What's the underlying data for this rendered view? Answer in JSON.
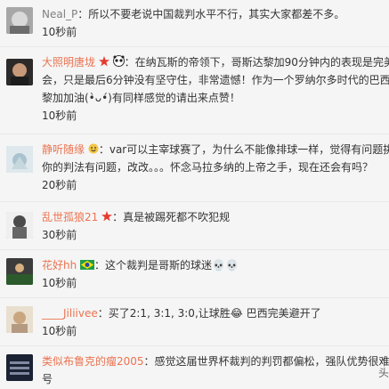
{
  "comments": [
    {
      "name": "Neal_P",
      "name_color": "#808080",
      "text_lines": [
        "：所以不要老说中国裁判水平不行，其实大家都差不多。"
      ],
      "time": "10秒前",
      "icons": []
    },
    {
      "name": "大照明唐垅",
      "name_color": "#eb7350",
      "text_lines": [
        "：在纳瓦斯的帝领下，哥斯达黎加90分钟内的表现是完美",
        "会，只是最后6分钟没有坚守住，非常遗憾！作为一个罗纳尔多时代的巴西",
        "黎加加油(•̀ᴗ•́)有同样感觉的请出来点赞！"
      ],
      "time": "10秒前",
      "icons": [
        "red-star-icon",
        "panda-icon"
      ]
    },
    {
      "name": "静听随缘",
      "name_color": "#eb7350",
      "text_lines": [
        "：var可以主宰球赛了，为什么不能像排球一样，觉得有问题挑战",
        "你的判法有问题，改改。。。怀念马拉多纳的上帝之手，现在还会有吗？"
      ],
      "time": "20秒前",
      "icons": [
        "emoji-icon"
      ]
    },
    {
      "name": "乱世孤狼21",
      "name_color": "#eb7350",
      "text_lines": [
        "：真是被踢死都不吹犯规"
      ],
      "time": "30秒前",
      "icons": [
        "red-star-icon"
      ]
    },
    {
      "name": "花好hh",
      "name_color": "#eb7350",
      "text_lines": [
        "：这个裁判是哥斯的球迷💀💀"
      ],
      "time": "10秒前",
      "icons": [
        "brazil-flag-icon"
      ]
    },
    {
      "name": "____Jiliivee",
      "name_color": "#eb7350",
      "text_lines": [
        "：买了2:1, 3:1, 3:0,让球胜😂 巴西完美避开了"
      ],
      "time": "10秒前",
      "icons": []
    },
    {
      "name": "类似布鲁克的瘤2005",
      "name_color": "#eb7350",
      "text_lines": [
        "：感觉这届世界杯裁判的判罚都偏松，强队优势很难体",
        "号"
      ],
      "time": "",
      "icons": []
    }
  ],
  "watermark": "头",
  "colors": {
    "name": "#eb7350",
    "name_gray": "#808080",
    "background": "#f5f5f5",
    "text": "#333333"
  }
}
